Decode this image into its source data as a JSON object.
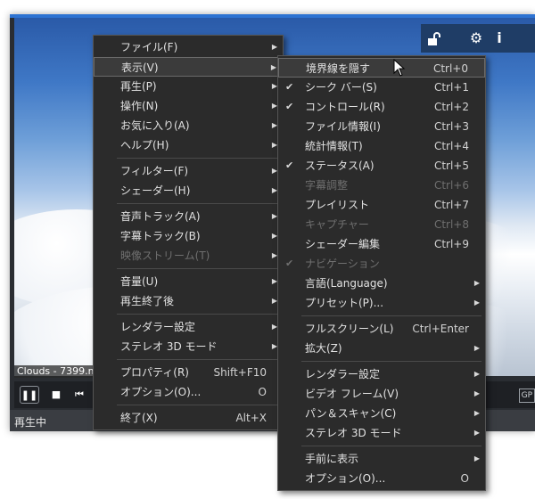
{
  "window": {
    "status_text": "再生中"
  },
  "video": {
    "filename": "Clouds - 7399.mp4"
  },
  "topbar": {
    "icons": [
      "unlock-icon",
      "gear-icon",
      "info-icon"
    ],
    "info_glyph": "i"
  },
  "controls": {
    "gpu_label": "GP"
  },
  "main_menu": {
    "items": [
      {
        "label": "ファイル(F)",
        "arrow": true
      },
      {
        "label": "表示(V)",
        "arrow": true,
        "highlight": true
      },
      {
        "label": "再生(P)",
        "arrow": true
      },
      {
        "label": "操作(N)",
        "arrow": true
      },
      {
        "label": "お気に入り(A)",
        "arrow": true
      },
      {
        "label": "ヘルプ(H)",
        "arrow": true
      },
      {
        "sep": true
      },
      {
        "label": "フィルター(F)",
        "arrow": true
      },
      {
        "label": "シェーダー(H)",
        "arrow": true
      },
      {
        "sep": true
      },
      {
        "label": "音声トラック(A)",
        "arrow": true
      },
      {
        "label": "字幕トラック(B)",
        "arrow": true
      },
      {
        "label": "映像ストリーム(T)",
        "arrow": true,
        "disabled": true
      },
      {
        "sep": true
      },
      {
        "label": "音量(U)",
        "arrow": true
      },
      {
        "label": "再生終了後",
        "arrow": true
      },
      {
        "sep": true
      },
      {
        "label": "レンダラー設定",
        "arrow": true
      },
      {
        "label": "ステレオ 3D モード",
        "arrow": true
      },
      {
        "sep": true
      },
      {
        "label": "プロパティ(R)",
        "shortcut": "Shift+F10"
      },
      {
        "label": "オプション(O)...",
        "shortcut": "O"
      },
      {
        "sep": true
      },
      {
        "label": "終了(X)",
        "shortcut": "Alt+X"
      }
    ]
  },
  "view_menu": {
    "items": [
      {
        "label": "境界線を隠す",
        "shortcut": "Ctrl+0",
        "highlight": true
      },
      {
        "label": "シーク バー(S)",
        "shortcut": "Ctrl+1",
        "checked": true
      },
      {
        "label": "コントロール(R)",
        "shortcut": "Ctrl+2",
        "checked": true
      },
      {
        "label": "ファイル情報(I)",
        "shortcut": "Ctrl+3"
      },
      {
        "label": "統計情報(T)",
        "shortcut": "Ctrl+4"
      },
      {
        "label": "ステータス(A)",
        "shortcut": "Ctrl+5",
        "checked": true
      },
      {
        "label": "字幕調整",
        "shortcut": "Ctrl+6",
        "disabled": true
      },
      {
        "label": "プレイリスト",
        "shortcut": "Ctrl+7"
      },
      {
        "label": "キャプチャー",
        "shortcut": "Ctrl+8",
        "disabled": true
      },
      {
        "label": "シェーダー編集",
        "shortcut": "Ctrl+9"
      },
      {
        "label": "ナビゲーション",
        "checked": true,
        "disabled": true
      },
      {
        "label": "言語(Language)",
        "arrow": true
      },
      {
        "label": "プリセット(P)...",
        "arrow": true
      },
      {
        "sep": true
      },
      {
        "label": "フルスクリーン(L)",
        "shortcut": "Ctrl+Enter"
      },
      {
        "label": "拡大(Z)",
        "arrow": true
      },
      {
        "sep": true
      },
      {
        "label": "レンダラー設定",
        "arrow": true
      },
      {
        "label": "ビデオ フレーム(V)",
        "arrow": true
      },
      {
        "label": "パン＆スキャン(C)",
        "arrow": true
      },
      {
        "label": "ステレオ 3D モード",
        "arrow": true
      },
      {
        "sep": true
      },
      {
        "label": "手前に表示",
        "arrow": true
      },
      {
        "label": "オプション(O)...",
        "shortcut": "O"
      }
    ]
  }
}
